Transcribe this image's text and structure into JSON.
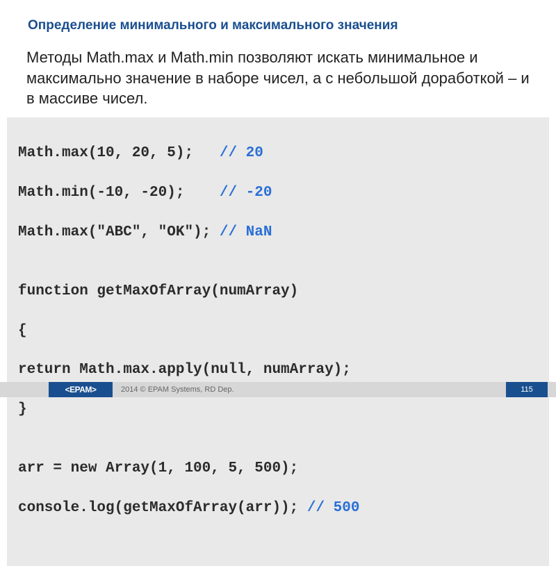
{
  "title": "Определение минимального и максимального значения",
  "description": "Методы Math.max и Math.min позволяют искать минимальное и максимально значение в наборе чисел, а с небольшой доработкой – и в массиве чисел.",
  "code": {
    "lines": [
      {
        "text": "Math.max(10, 20, 5);   ",
        "comment": "// 20"
      },
      {
        "text": "Math.min(-10, -20);    ",
        "comment": "// -20"
      },
      {
        "text": "Math.max(\"ABC\", \"OK\"); ",
        "comment": "// NaN"
      },
      {
        "text": "",
        "comment": ""
      },
      {
        "text": "function getMaxOfArray(numArray)",
        "comment": ""
      },
      {
        "text": "{",
        "comment": ""
      },
      {
        "text": "return Math.max.apply(null, numArray);",
        "comment": ""
      },
      {
        "text": "}",
        "comment": ""
      },
      {
        "text": "",
        "comment": ""
      },
      {
        "text": "arr = new Array(1, 100, 5, 500);",
        "comment": ""
      },
      {
        "text": "console.log(getMaxOfArray(arr)); ",
        "comment": "// 500"
      }
    ]
  },
  "footer": {
    "logo": "<EPAM>",
    "copyright": "2014 © EPAM Systems, RD Dep.",
    "page": "115"
  }
}
